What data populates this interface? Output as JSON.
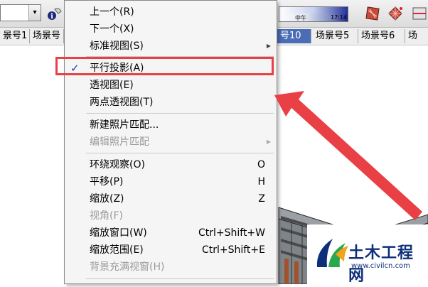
{
  "toolbar": {
    "combo_arrow": "▾",
    "info_icon": "info-icon",
    "sun_time_left": "中午",
    "sun_time_right": "17:14"
  },
  "tabs": [
    {
      "label": "景号1"
    },
    {
      "label": "场景号"
    },
    {
      "label": "号10"
    },
    {
      "label": "场景号5"
    },
    {
      "label": "场景号6"
    },
    {
      "label": "场"
    }
  ],
  "menu": {
    "items": [
      {
        "label": "上一个(R)",
        "shortcut": "",
        "disabled": false,
        "checked": false,
        "submenu": false
      },
      {
        "label": "下一个(X)",
        "shortcut": "",
        "disabled": false,
        "checked": false,
        "submenu": false
      },
      {
        "label": "标准视图(S)",
        "shortcut": "",
        "disabled": false,
        "checked": false,
        "submenu": true
      },
      {
        "label": "平行投影(A)",
        "shortcut": "",
        "disabled": false,
        "checked": true,
        "submenu": false
      },
      {
        "label": "透视图(E)",
        "shortcut": "",
        "disabled": false,
        "checked": false,
        "submenu": false
      },
      {
        "label": "两点透视图(T)",
        "shortcut": "",
        "disabled": false,
        "checked": false,
        "submenu": false
      },
      {
        "label": "新建照片匹配...",
        "shortcut": "",
        "disabled": false,
        "checked": false,
        "submenu": false
      },
      {
        "label": "编辑照片匹配",
        "shortcut": "",
        "disabled": true,
        "checked": false,
        "submenu": true
      },
      {
        "label": "环绕观察(O)",
        "shortcut": "O",
        "disabled": false,
        "checked": false,
        "submenu": false
      },
      {
        "label": "平移(P)",
        "shortcut": "H",
        "disabled": false,
        "checked": false,
        "submenu": false
      },
      {
        "label": "缩放(Z)",
        "shortcut": "Z",
        "disabled": false,
        "checked": false,
        "submenu": false
      },
      {
        "label": "视角(F)",
        "shortcut": "",
        "disabled": true,
        "checked": false,
        "submenu": false
      },
      {
        "label": "缩放窗口(W)",
        "shortcut": "Ctrl+Shift+W",
        "disabled": false,
        "checked": false,
        "submenu": false
      },
      {
        "label": "缩放范围(E)",
        "shortcut": "Ctrl+Shift+E",
        "disabled": false,
        "checked": false,
        "submenu": false
      },
      {
        "label": "背景充满视窗(H)",
        "shortcut": "",
        "disabled": true,
        "checked": false,
        "submenu": false
      }
    ],
    "check_glyph": "✓",
    "submenu_glyph": "▶"
  },
  "annotation": {
    "color": "#e84045"
  },
  "watermark": {
    "title": "土木工程网",
    "url": "www.civilcn.com",
    "colors": {
      "blue": "#0d2f7a",
      "green": "#2aa84a",
      "orange": "#f2a21b"
    }
  },
  "colors": {
    "active_tab": "#4a6db6",
    "menu_bg": "#f5f5f5",
    "check": "#1c3f9e"
  }
}
